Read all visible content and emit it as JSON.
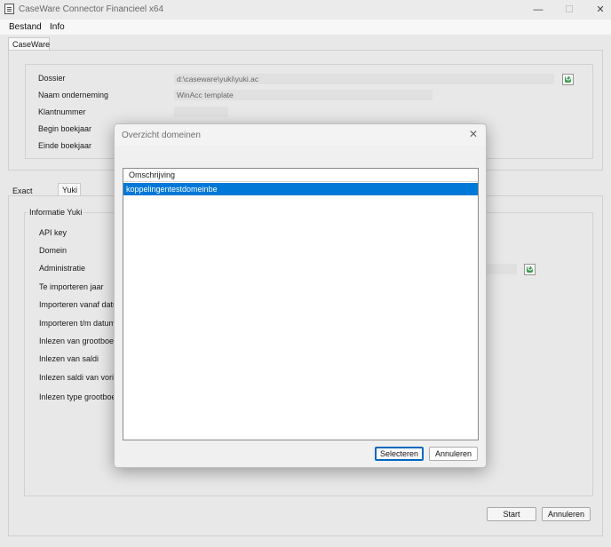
{
  "window": {
    "title": "CaseWare Connector Financieel x64",
    "minimize": "—",
    "maximize": "☐",
    "close": "✕"
  },
  "menu": [
    "Bestand",
    "Info"
  ],
  "top_tab": "CaseWare",
  "caseware": {
    "labels": [
      "Dossier",
      "Naam onderneming",
      "Klantnummer",
      "Begin boekjaar",
      "Einde boekjaar"
    ],
    "dossier_value": "d:\\caseware\\yuki\\yuki.ac",
    "naam_value": "WinAcc template"
  },
  "lower_tabs": [
    "Exact Online",
    "Yuki"
  ],
  "yuki": {
    "group_title": "Informatie Yuki",
    "labels": [
      "API key",
      "Domein",
      "Administratie",
      "Te importeren jaar",
      "Importeren vanaf datum",
      "Importeren t/m datum",
      "Inlezen van grootboekrekeningen",
      "Inlezen van saldi",
      "Inlezen saldi van vorig boekjaar",
      "Inlezen type grootboekrekeningen"
    ]
  },
  "buttons": {
    "start": "Start",
    "annuleren": "Annuleren"
  },
  "dialog": {
    "title": "Overzicht domeinen",
    "close": "✕",
    "column_header": "Omschrijving",
    "rows": [
      "koppelingentestdomeinbe"
    ],
    "select_button": "Selecteren",
    "cancel_button": "Annuleren"
  },
  "colors": {
    "selection": "#0078d7",
    "accent_border": "#0067c0",
    "refresh_icon": "#3fa052"
  }
}
